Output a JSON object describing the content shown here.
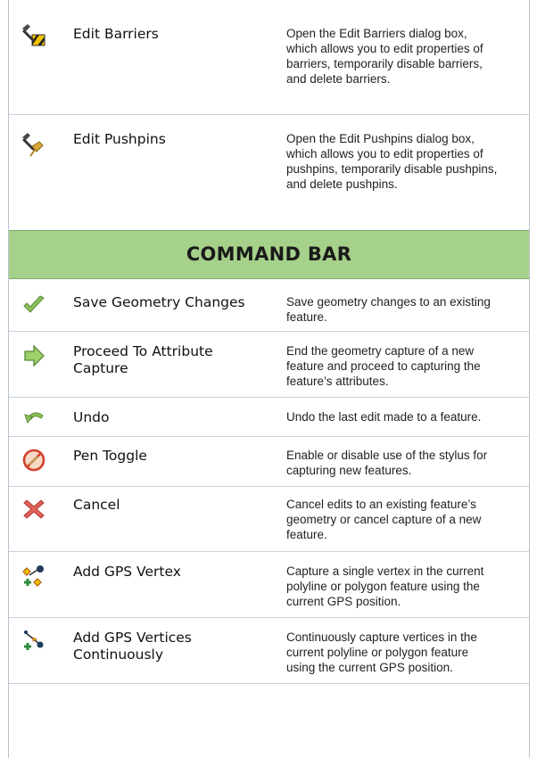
{
  "rows_top": [
    {
      "name": "Edit Barriers",
      "desc_lines": [
        "Open the Edit Barriers dialog box,",
        "which allows you to edit properties of",
        "barriers, temporarily disable barriers,",
        "and delete barriers."
      ],
      "icon": "edit-barriers-icon"
    },
    {
      "name": "Edit Pushpins",
      "desc_lines": [
        "Open the Edit Pushpins dialog box,",
        "which allows you to edit properties of",
        "pushpins, temporarily disable pushpins,",
        "and delete pushpins."
      ],
      "icon": "edit-pushpins-icon"
    }
  ],
  "section": {
    "title": "COMMAND BAR",
    "color": "#a6d18a"
  },
  "rows_cmd": [
    {
      "name_lines": [
        "Save Geometry Changes"
      ],
      "desc_lines": [
        "Save geometry changes to an existing",
        "feature."
      ],
      "icon": "checkmark-icon"
    },
    {
      "name_lines": [
        "Proceed To Attribute",
        "Capture"
      ],
      "desc_lines": [
        "End the geometry capture of a new",
        "feature and proceed to capturing the",
        "feature’s attributes."
      ],
      "icon": "right-arrow-icon"
    },
    {
      "name_lines": [
        "Undo"
      ],
      "desc_lines": [
        "Undo the last edit made to a feature."
      ],
      "icon": "undo-icon"
    },
    {
      "name_lines": [
        "Pen Toggle"
      ],
      "desc_lines": [
        "Enable or disable use of the stylus for",
        "capturing new features."
      ],
      "icon": "pen-toggle-icon"
    },
    {
      "name_lines": [
        "Cancel"
      ],
      "desc_lines": [
        "Cancel edits to an existing feature’s",
        "geometry or cancel capture of a new",
        "feature."
      ],
      "icon": "cancel-x-icon"
    },
    {
      "name_lines": [
        "Add GPS Vertex"
      ],
      "desc_lines": [
        "Capture a single vertex in the current",
        "polyline or polygon feature using the",
        "current GPS position."
      ],
      "icon": "add-gps-vertex-icon"
    },
    {
      "name_lines": [
        "Add GPS Vertices",
        "Continuously"
      ],
      "desc_lines": [
        "Continuously capture vertices in the",
        "current polyline or polygon feature",
        "using the current GPS position."
      ],
      "icon": "add-gps-vertices-icon"
    }
  ]
}
